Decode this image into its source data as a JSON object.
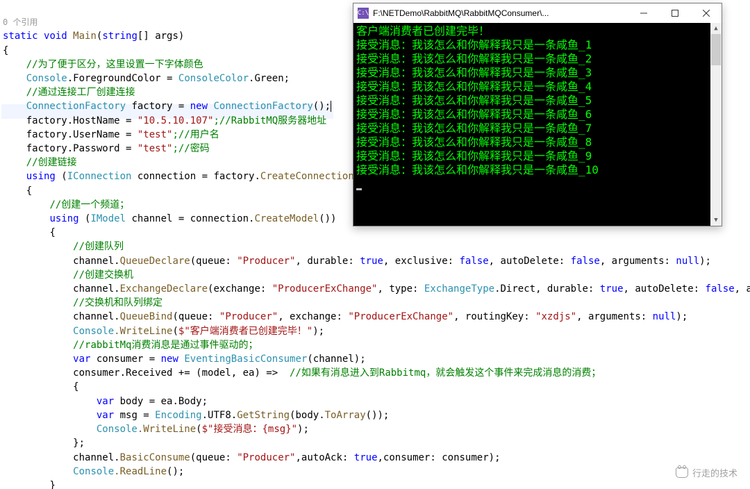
{
  "editor": {
    "ref_hint": "0 个引用",
    "lines": {
      "l1_static": "static",
      "l1_void": "void",
      "l1_main": "Main",
      "l1_string": "string",
      "l1_args": "[] args)",
      "l2": "{",
      "l3_cmt": "//为了便于区分，这里设置一下字体颜色",
      "l4_console": "Console",
      "l4_fg": ".ForegroundColor = ",
      "l4_cc": "ConsoleColor",
      "l4_green": ".Green;",
      "l5_cmt": "//通过连接工厂创建连接",
      "l6_cf": "ConnectionFactory",
      "l6_fac": " factory = ",
      "l6_new": "new",
      "l6_cf2": "ConnectionFactory",
      "l6_end": "();",
      "l7_a": "factory.HostName = ",
      "l7_str": "\"10.5.10.107\"",
      "l7_cmt": ";//RabbitMQ服务器地址",
      "l8_a": "factory.UserName = ",
      "l8_str": "\"test\"",
      "l8_cmt": ";//用户名",
      "l9_a": "factory.Password = ",
      "l9_str": "\"test\"",
      "l9_cmt": ";//密码",
      "l10_cmt": "//创建链接",
      "l11_using": "using",
      "l11_a": " (",
      "l11_icon": "IConnection",
      "l11_b": " connection = factory.",
      "l11_cc": "CreateConnection",
      "l11_end": "())",
      "l12": "{",
      "l13_cmt": "//创建一个频道；",
      "l14_using": "using",
      "l14_a": " (",
      "l14_imodel": "IModel",
      "l14_b": " channel = connection.",
      "l14_cm": "CreateModel",
      "l14_end": "())",
      "l15": "{",
      "l16_cmt": "//创建队列",
      "l17_a": "channel.",
      "l17_qd": "QueueDeclare",
      "l17_b": "(queue: ",
      "l17_s1": "\"Producer\"",
      "l17_c": ", durable: ",
      "l17_t": "true",
      "l17_d": ", exclusive: ",
      "l17_f1": "false",
      "l17_e": ", autoDelete: ",
      "l17_f2": "false",
      "l17_g": ", arguments: ",
      "l17_n": "null",
      "l17_end": ");",
      "l18_cmt": "//创建交换机",
      "l19_a": "channel.",
      "l19_ed": "ExchangeDeclare",
      "l19_b": "(exchange: ",
      "l19_s1": "\"ProducerExChange\"",
      "l19_c": ", type: ",
      "l19_et": "ExchangeType",
      "l19_d": ".Direct, durable: ",
      "l19_t": "true",
      "l19_e": ", autoDelete: ",
      "l19_f": "false",
      "l19_g": ", arguments",
      "l20_cmt": "//交换机和队列绑定",
      "l21_a": "channel.",
      "l21_qb": "QueueBind",
      "l21_b": "(queue: ",
      "l21_s1": "\"Producer\"",
      "l21_c": ", exchange: ",
      "l21_s2": "\"ProducerExChange\"",
      "l21_d": ", routingKey: ",
      "l21_s3": "\"xzdjs\"",
      "l21_e": ", arguments: ",
      "l21_n": "null",
      "l21_end": ");",
      "l22_c": "Console",
      "l22_wl": ".WriteLine",
      "l22_a": "(",
      "l22_s": "$\"客户端消费者已创建完毕！\"",
      "l22_end": ");",
      "l23_cmt": "//rabbitMq消费消息是通过事件驱动的；",
      "l24_var": "var",
      "l24_a": " consumer = ",
      "l24_new": "new",
      "l24_ebc": " EventingBasicConsumer",
      "l24_end": "(channel);",
      "l25_a": "consumer.Received += (model, ea) =>  ",
      "l25_cmt": "//如果有消息进入到Rabbitmq，就会触发这个事件来完成消息的消费；",
      "l26": "{",
      "l27_var": "var",
      "l27_a": " body = ea.Body;",
      "l28_var": "var",
      "l28_a": " msg = ",
      "l28_enc": "Encoding",
      "l28_b": ".UTF8.",
      "l28_gs": "GetString",
      "l28_c": "(body.",
      "l28_ta": "ToArray",
      "l28_end": "());",
      "l29_c": "Console",
      "l29_wl": ".WriteLine",
      "l29_a": "(",
      "l29_s": "$\"接受消息：{msg}\"",
      "l29_end": ");",
      "l30": "};",
      "l31_a": "channel.",
      "l31_bc": "BasicConsume",
      "l31_b": "(queue: ",
      "l31_s": "\"Producer\"",
      "l31_c": ",autoAck: ",
      "l31_t": "true",
      "l31_d": ",consumer: consumer);",
      "l32_c": "Console",
      "l32_rl": ".ReadLine",
      "l32_end": "();",
      "l33": "}"
    }
  },
  "console": {
    "icon_text": "C:\\",
    "title": "F:\\NETDemo\\RabbitMQ\\RabbitMQConsumer\\...",
    "lines": [
      "客户端消费者已创建完毕！",
      "接受消息：我该怎么和你解释我只是一条咸鱼_1",
      "接受消息：我该怎么和你解释我只是一条咸鱼_2",
      "接受消息：我该怎么和你解释我只是一条咸鱼_3",
      "接受消息：我该怎么和你解释我只是一条咸鱼_4",
      "接受消息：我该怎么和你解释我只是一条咸鱼_5",
      "接受消息：我该怎么和你解释我只是一条咸鱼_6",
      "接受消息：我该怎么和你解释我只是一条咸鱼_7",
      "接受消息：我该怎么和你解释我只是一条咸鱼_8",
      "接受消息：我该怎么和你解释我只是一条咸鱼_9",
      "接受消息：我该怎么和你解释我只是一条咸鱼_10"
    ]
  },
  "watermark": "行走的技术"
}
